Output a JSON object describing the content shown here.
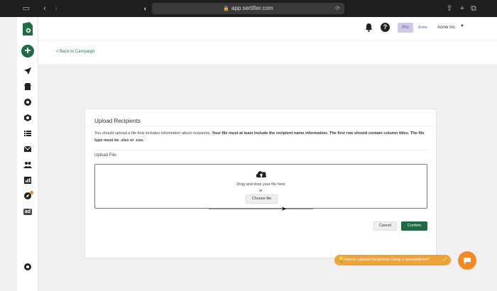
{
  "browser": {
    "url": "app.sertifier.com"
  },
  "topbar": {
    "plan_badge": "Pro",
    "company_logo_text": "Acme",
    "company_name": "Acme Inc."
  },
  "nav": {
    "back_label": "< Back to Campaign"
  },
  "card": {
    "title": "Upload Recipients",
    "description_plain": "You should upload a file that includes information about recipients.",
    "description_bold": "Your file must at least include the recipient name information. The first row should contain column titles. The file type must be .xlsx or .csv.",
    "upload_label": "Upload File:",
    "drop_text": "Drag and drop your file here",
    "or_text": "or",
    "choose_file_label": "Choose file",
    "cancel_label": "Cancel",
    "confirm_label": "Confirm"
  },
  "help": {
    "pill_text": "How to Upload Recipients Using a Spreadsheet?"
  },
  "sidebar": {
    "items": [
      {
        "icon": "send-icon"
      },
      {
        "icon": "store-icon"
      },
      {
        "icon": "badge-icon"
      },
      {
        "icon": "hexagon-icon"
      },
      {
        "icon": "list-icon"
      },
      {
        "icon": "mail-icon"
      },
      {
        "icon": "users-icon"
      },
      {
        "icon": "chart-icon"
      },
      {
        "icon": "compass-icon"
      },
      {
        "icon": "ad-icon",
        "label": "ad"
      }
    ]
  },
  "colors": {
    "brand_green": "#1f6b46",
    "accent_orange": "#f08a24",
    "help_pill": "#f0a23a"
  }
}
